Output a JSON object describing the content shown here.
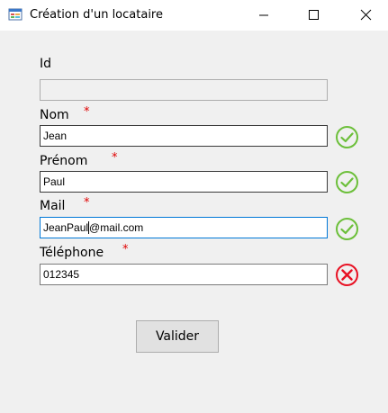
{
  "window": {
    "title": "Création d'un locataire",
    "icon": "form-app-icon",
    "controls": [
      "minimize-icon",
      "maximize-icon",
      "close-icon"
    ]
  },
  "form": {
    "required_marker": "*",
    "fields": {
      "id": {
        "label": "Id",
        "value": "",
        "required": false,
        "enabled": false
      },
      "nom": {
        "label": "Nom",
        "value": "Jean",
        "required": true,
        "valid": true
      },
      "prenom": {
        "label": "Prénom",
        "value": "Paul",
        "required": true,
        "valid": true
      },
      "mail": {
        "label": "Mail",
        "value_before_caret": "JeanPaul",
        "value_after_caret": "@mail.com",
        "required": true,
        "valid": true,
        "focused": true
      },
      "telephone": {
        "label": "Téléphone",
        "value": "012345",
        "required": true,
        "valid": false
      }
    },
    "submit_label": "Valider"
  },
  "colors": {
    "valid": "#6cbf3a",
    "invalid": "#e81123",
    "required_star": "#e00000",
    "focus_border": "#0078d7"
  }
}
